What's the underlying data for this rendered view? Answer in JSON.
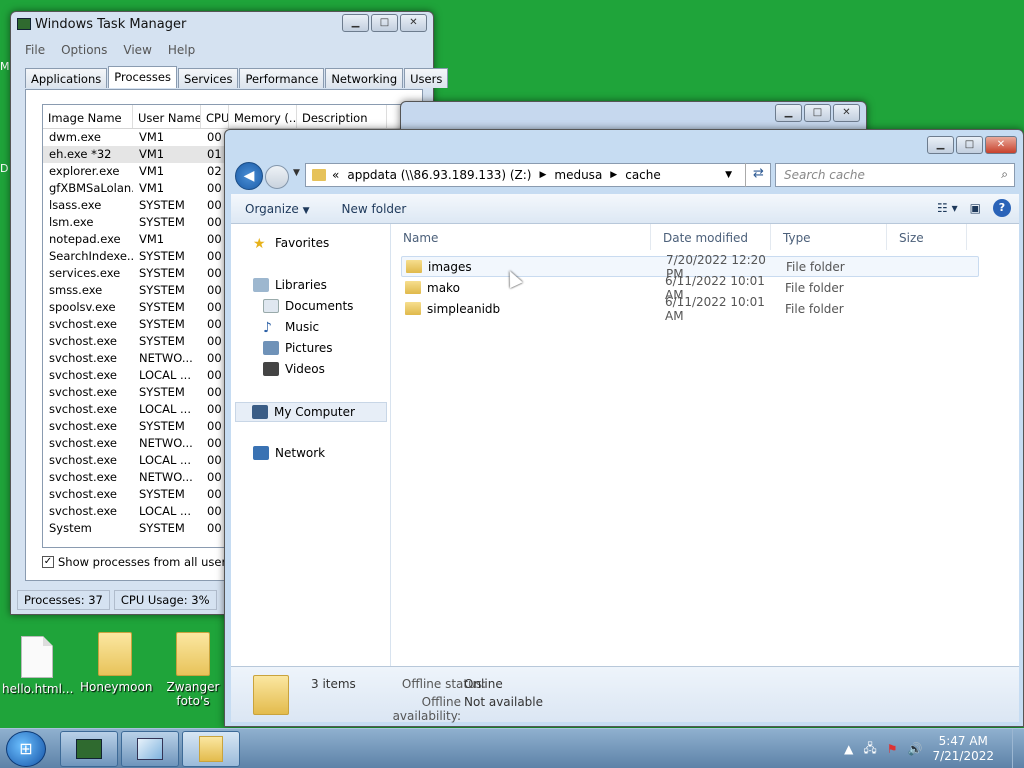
{
  "desktop": {
    "icons": [
      {
        "label": "hello.html...",
        "type": "document"
      },
      {
        "label": "Honeymoon",
        "type": "folder"
      },
      {
        "label": "Zwanger foto's",
        "type": "folder"
      }
    ]
  },
  "taskmgr": {
    "title": "Windows Task Manager",
    "menu": [
      "File",
      "Options",
      "View",
      "Help"
    ],
    "tabs": [
      "Applications",
      "Processes",
      "Services",
      "Performance",
      "Networking",
      "Users"
    ],
    "active_tab": "Processes",
    "columns": [
      "Image Name",
      "User Name",
      "CPU",
      "Memory (...",
      "Description"
    ],
    "processes": [
      {
        "name": "dwm.exe",
        "user": "VM1",
        "cpu": "00"
      },
      {
        "name": "eh.exe *32",
        "user": "VM1",
        "cpu": "01"
      },
      {
        "name": "explorer.exe",
        "user": "VM1",
        "cpu": "02"
      },
      {
        "name": "gfXBMSaLolan...",
        "user": "VM1",
        "cpu": "00"
      },
      {
        "name": "lsass.exe",
        "user": "SYSTEM",
        "cpu": "00"
      },
      {
        "name": "lsm.exe",
        "user": "SYSTEM",
        "cpu": "00"
      },
      {
        "name": "notepad.exe",
        "user": "VM1",
        "cpu": "00"
      },
      {
        "name": "SearchIndexe...",
        "user": "SYSTEM",
        "cpu": "00"
      },
      {
        "name": "services.exe",
        "user": "SYSTEM",
        "cpu": "00"
      },
      {
        "name": "smss.exe",
        "user": "SYSTEM",
        "cpu": "00"
      },
      {
        "name": "spoolsv.exe",
        "user": "SYSTEM",
        "cpu": "00"
      },
      {
        "name": "svchost.exe",
        "user": "SYSTEM",
        "cpu": "00"
      },
      {
        "name": "svchost.exe",
        "user": "SYSTEM",
        "cpu": "00"
      },
      {
        "name": "svchost.exe",
        "user": "NETWO...",
        "cpu": "00"
      },
      {
        "name": "svchost.exe",
        "user": "LOCAL ...",
        "cpu": "00"
      },
      {
        "name": "svchost.exe",
        "user": "SYSTEM",
        "cpu": "00"
      },
      {
        "name": "svchost.exe",
        "user": "LOCAL ...",
        "cpu": "00"
      },
      {
        "name": "svchost.exe",
        "user": "SYSTEM",
        "cpu": "00"
      },
      {
        "name": "svchost.exe",
        "user": "NETWO...",
        "cpu": "00"
      },
      {
        "name": "svchost.exe",
        "user": "LOCAL ...",
        "cpu": "00"
      },
      {
        "name": "svchost.exe",
        "user": "NETWO...",
        "cpu": "00"
      },
      {
        "name": "svchost.exe",
        "user": "SYSTEM",
        "cpu": "00"
      },
      {
        "name": "svchost.exe",
        "user": "LOCAL ...",
        "cpu": "00"
      },
      {
        "name": "System",
        "user": "SYSTEM",
        "cpu": "00"
      }
    ],
    "show_all_label": "Show processes from all users",
    "status_processes": "Processes: 37",
    "status_cpu": "CPU Usage: 3%"
  },
  "explorer": {
    "breadcrumb": [
      "appdata (\\\\86.93.189.133) (Z:)",
      "medusa",
      "cache"
    ],
    "breadcrumb_prefix": "«",
    "search_placeholder": "Search cache",
    "organize_label": "Organize",
    "new_folder_label": "New folder",
    "nav": {
      "favorites": "Favorites",
      "libraries": "Libraries",
      "documents": "Documents",
      "music": "Music",
      "pictures": "Pictures",
      "videos": "Videos",
      "computer": "My Computer",
      "network": "Network"
    },
    "columns": {
      "name": "Name",
      "date": "Date modified",
      "type": "Type",
      "size": "Size"
    },
    "files": [
      {
        "name": "images",
        "date": "7/20/2022 12:20 PM",
        "type": "File folder"
      },
      {
        "name": "mako",
        "date": "6/11/2022 10:01 AM",
        "type": "File folder"
      },
      {
        "name": "simpleanidb",
        "date": "6/11/2022 10:01 AM",
        "type": "File folder"
      }
    ],
    "details": {
      "items": "3 items",
      "offline_status_label": "Offline status:",
      "offline_status_value": "Online",
      "offline_avail_label": "Offline availability:",
      "offline_avail_value": "Not available"
    }
  },
  "taskbar": {
    "time": "5:47 AM",
    "date": "7/21/2022"
  }
}
